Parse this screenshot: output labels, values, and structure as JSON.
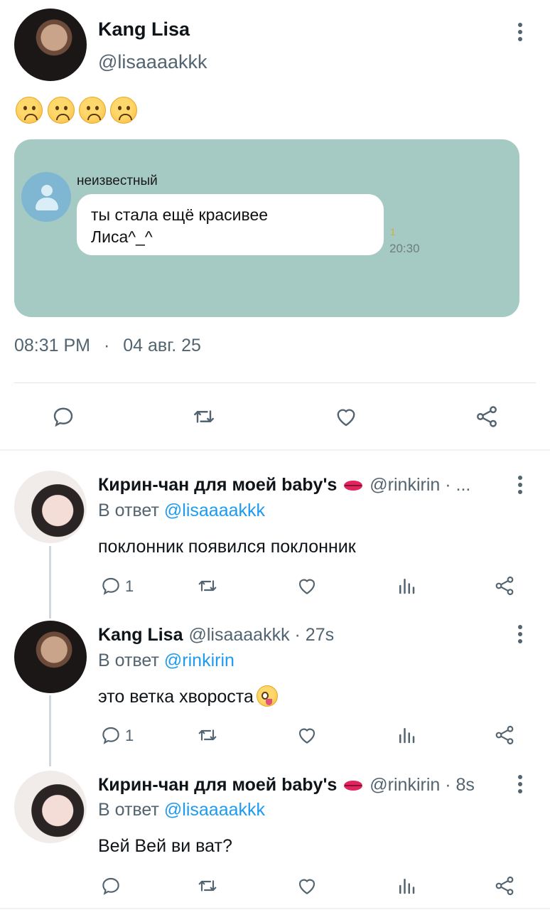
{
  "tweet": {
    "author_name": "Kang Lisa",
    "author_handle": "@lisaaaakkk",
    "text_emoji": "☹☹☹☹",
    "chat": {
      "sender": "неизвестный",
      "message_line1": "ты стала ещё красивее",
      "message_line2": "Лиса^_^",
      "count": "1",
      "time": "20:30"
    },
    "time": "08:31 PM",
    "separator": "·",
    "date": "04 авг. 25",
    "actions": [
      "reply-icon",
      "retweet-icon",
      "like-icon",
      "share-icon"
    ]
  },
  "replies": [
    {
      "name": "Кирин-чан для моей baby's",
      "badge": "kiss-icon",
      "meta": "@rinkirin · ...",
      "reply_prefix": "В ответ ",
      "reply_to": "@lisaaaakkk",
      "text": "поклонник появился поклонник",
      "reply_count": "1"
    },
    {
      "name": "Kang Lisa",
      "meta": "@lisaaaakkk · 27s",
      "reply_prefix": "В ответ ",
      "reply_to": "@rinkirin",
      "text": "это ветка хвороста",
      "emoji": "zany-face",
      "reply_count": "1"
    },
    {
      "name": "Кирин-чан для моей baby's",
      "badge": "kiss-icon",
      "meta": "@rinkirin · 8s",
      "reply_prefix": "В ответ ",
      "reply_to": "@lisaaaakkk",
      "text": "Вей Вей ви ват?",
      "reply_count": ""
    }
  ],
  "colors": {
    "accent": "#1d9bf0",
    "muted": "#536471",
    "media_bg": "#a5c9c3"
  }
}
